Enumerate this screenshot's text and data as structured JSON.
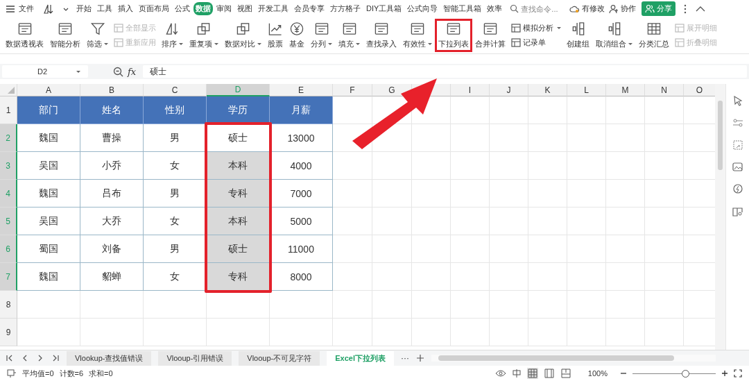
{
  "menu": {
    "file": "文件",
    "tabs": [
      {
        "label": "开始",
        "selected": false
      },
      {
        "label": "工具",
        "selected": false
      },
      {
        "label": "插入",
        "selected": false
      },
      {
        "label": "页面布局",
        "selected": false
      },
      {
        "label": "公式",
        "selected": false
      },
      {
        "label": "数据",
        "selected": true
      },
      {
        "label": "审阅",
        "selected": false
      },
      {
        "label": "视图",
        "selected": false
      },
      {
        "label": "开发工具",
        "selected": false
      },
      {
        "label": "会员专享",
        "selected": false
      },
      {
        "label": "方方格子",
        "selected": false
      },
      {
        "label": "DIY工具箱",
        "selected": false
      },
      {
        "label": "公式向导",
        "selected": false
      },
      {
        "label": "智能工具箱",
        "selected": false
      },
      {
        "label": "效率",
        "selected": false
      }
    ],
    "search": {
      "placeholder": "查找命令..."
    },
    "modified": "有修改",
    "collab": "协作",
    "share": "分享"
  },
  "ribbon": [
    {
      "kind": "large",
      "label": "数据透视表",
      "dropdown": false,
      "highlighted": false
    },
    {
      "kind": "large",
      "label": "智能分析",
      "dropdown": false,
      "highlighted": false
    },
    {
      "kind": "large",
      "label": "筛选",
      "dropdown": true,
      "highlighted": false
    },
    {
      "kind": "stack",
      "items": [
        {
          "label": "全部显示",
          "disabled": true,
          "dropdown": false
        },
        {
          "label": "重新应用",
          "disabled": true,
          "dropdown": false
        }
      ]
    },
    {
      "kind": "large",
      "label": "排序",
      "dropdown": true,
      "highlighted": false
    },
    {
      "kind": "large",
      "label": "重复项",
      "dropdown": true,
      "highlighted": false
    },
    {
      "kind": "large",
      "label": "数据对比",
      "dropdown": true,
      "highlighted": false
    },
    {
      "kind": "large",
      "label": "股票",
      "dropdown": false,
      "highlighted": false
    },
    {
      "kind": "large",
      "label": "基金",
      "dropdown": false,
      "highlighted": false
    },
    {
      "kind": "large",
      "label": "分列",
      "dropdown": true,
      "highlighted": false
    },
    {
      "kind": "large",
      "label": "填充",
      "dropdown": true,
      "highlighted": false
    },
    {
      "kind": "large",
      "label": "查找录入",
      "dropdown": false,
      "highlighted": false
    },
    {
      "kind": "large",
      "label": "有效性",
      "dropdown": true,
      "highlighted": false
    },
    {
      "kind": "large",
      "label": "下拉列表",
      "dropdown": false,
      "highlighted": true
    },
    {
      "kind": "large",
      "label": "合并计算",
      "dropdown": false,
      "highlighted": false
    },
    {
      "kind": "stack",
      "items": [
        {
          "label": "模拟分析",
          "disabled": false,
          "dropdown": true
        },
        {
          "label": "记录单",
          "disabled": false,
          "dropdown": false
        }
      ]
    },
    {
      "kind": "large",
      "label": "创建组",
      "dropdown": false,
      "highlighted": false
    },
    {
      "kind": "large",
      "label": "取消组合",
      "dropdown": true,
      "highlighted": false
    },
    {
      "kind": "large",
      "label": "分类汇总",
      "dropdown": false,
      "highlighted": false
    },
    {
      "kind": "stack",
      "items": [
        {
          "label": "展开明细",
          "disabled": true,
          "dropdown": false
        },
        {
          "label": "折叠明细",
          "disabled": true,
          "dropdown": false
        }
      ]
    }
  ],
  "formula_bar": {
    "name_box": "D2",
    "fx": "fx",
    "value": "硕士"
  },
  "sheet": {
    "columns": [
      {
        "label": "A",
        "selected": false
      },
      {
        "label": "B",
        "selected": false
      },
      {
        "label": "C",
        "selected": false
      },
      {
        "label": "D",
        "selected": true
      },
      {
        "label": "E",
        "selected": false
      },
      {
        "label": "F",
        "selected": false
      },
      {
        "label": "G",
        "selected": false
      },
      {
        "selected": false
      },
      {
        "label": "I",
        "selected": false
      },
      {
        "label": "J",
        "selected": false
      },
      {
        "label": "K",
        "selected": false
      },
      {
        "label": "L",
        "selected": false
      },
      {
        "label": "M",
        "selected": false
      },
      {
        "label": "N",
        "selected": false
      },
      {
        "label": "O",
        "selected": false
      }
    ],
    "rows": [
      {
        "label": "1",
        "selected": false,
        "cells": [
          "部门",
          "姓名",
          "性别",
          "学历",
          "月薪"
        ]
      },
      {
        "label": "2",
        "selected": true,
        "cells": [
          "魏国",
          "曹操",
          "男",
          "硕士",
          "13000"
        ]
      },
      {
        "label": "3",
        "selected": true,
        "cells": [
          "吴国",
          "小乔",
          "女",
          "本科",
          "4000"
        ]
      },
      {
        "label": "4",
        "selected": true,
        "cells": [
          "魏国",
          "吕布",
          "男",
          "专科",
          "7000"
        ]
      },
      {
        "label": "5",
        "selected": true,
        "cells": [
          "吴国",
          "大乔",
          "女",
          "本科",
          "5000"
        ]
      },
      {
        "label": "6",
        "selected": true,
        "cells": [
          "蜀国",
          "刘备",
          "男",
          "硕士",
          "11000"
        ]
      },
      {
        "label": "7",
        "selected": true,
        "cells": [
          "魏国",
          "貂蝉",
          "女",
          "专科",
          "8000"
        ]
      },
      {
        "label": "8",
        "selected": false,
        "cells": []
      },
      {
        "label": "9",
        "selected": false,
        "cells": []
      }
    ]
  },
  "annotation": {
    "selection_outline": true,
    "arrow": true
  },
  "sheet_tabs": [
    {
      "label": "Vlookup-查找值错误",
      "selected": false
    },
    {
      "label": "Vlooup-引用错误",
      "selected": false
    },
    {
      "label": "Vlooup-不可见字符",
      "selected": false
    },
    {
      "label": "Excel下拉列表",
      "selected": true
    }
  ],
  "sheet_more": "···",
  "status": {
    "items": [
      "平均值=0",
      "计数=6",
      "求和=0"
    ],
    "zoom": "100%",
    "zoom_slider": {
      "level": 0.63
    }
  }
}
